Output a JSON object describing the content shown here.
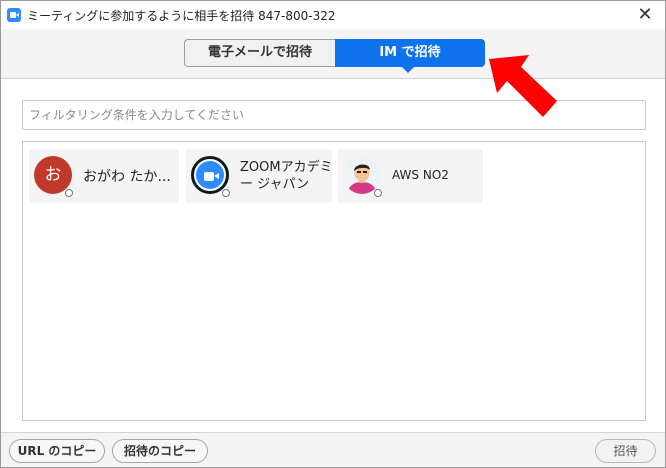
{
  "window": {
    "title": "ミーティングに参加するように相手を招待 847-800-322",
    "close_glyph": "✕"
  },
  "tabs": [
    {
      "label": "電子メールで招待",
      "selected": false
    },
    {
      "label": "IM で招待",
      "selected": true
    }
  ],
  "filter": {
    "placeholder": "フィルタリング条件を入力してください",
    "value": ""
  },
  "contacts": [
    {
      "name": "おがわ たか...",
      "avatar_text": "お",
      "avatar_type": "initial",
      "avatar_color": "#c0392b"
    },
    {
      "name_line1": "ZOOMアカデミ",
      "name_line2": "ー ジャパン",
      "avatar_type": "zoom-logo"
    },
    {
      "name": "AWS NO2",
      "avatar_type": "photo"
    }
  ],
  "bottom": {
    "copy_url": "URL のコピー",
    "copy_invitation": "招待のコピー",
    "invite": "招待"
  },
  "colors": {
    "accent": "#0e72ed",
    "annotation_arrow": "#ff0000"
  },
  "annotation": {
    "type": "red-arrow",
    "points_to": "IM で招待"
  }
}
